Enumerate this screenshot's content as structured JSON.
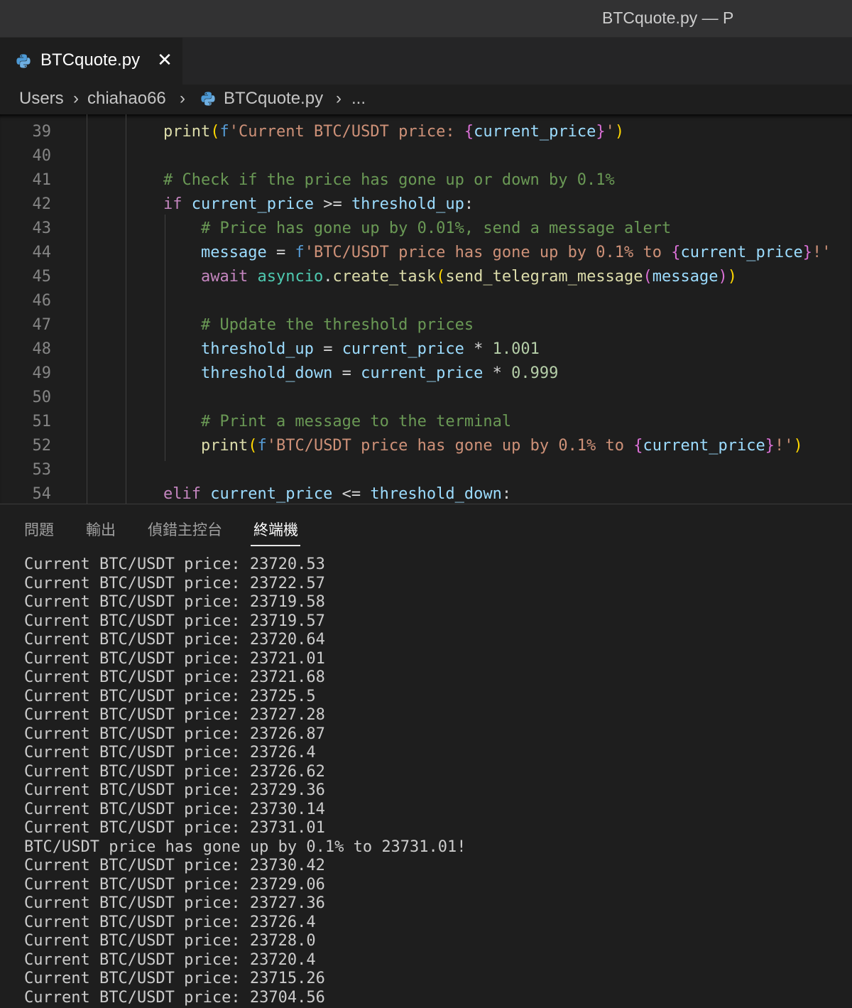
{
  "window": {
    "title": "BTCquote.py — P"
  },
  "tabs": [
    {
      "label": "BTCquote.py",
      "close": "✕"
    }
  ],
  "breadcrumb": {
    "items": [
      "Users",
      "chiahao66",
      "BTCquote.py",
      "..."
    ],
    "separator": "›"
  },
  "editor": {
    "lines": [
      {
        "num": "39",
        "text": "print(f'Current BTC/USDT price: {current_price}')"
      },
      {
        "num": "40",
        "text": ""
      },
      {
        "num": "41",
        "text": "# Check if the price has gone up or down by 0.1%"
      },
      {
        "num": "42",
        "text": "if current_price >= threshold_up:"
      },
      {
        "num": "43",
        "text": "    # Price has gone up by 0.01%, send a message alert"
      },
      {
        "num": "44",
        "text": "    message = f'BTC/USDT price has gone up by 0.1% to {current_price}!'"
      },
      {
        "num": "45",
        "text": "    await asyncio.create_task(send_telegram_message(message))"
      },
      {
        "num": "46",
        "text": ""
      },
      {
        "num": "47",
        "text": "    # Update the threshold prices"
      },
      {
        "num": "48",
        "text": "    threshold_up = current_price * 1.001"
      },
      {
        "num": "49",
        "text": "    threshold_down = current_price * 0.999"
      },
      {
        "num": "50",
        "text": ""
      },
      {
        "num": "51",
        "text": "    # Print a message to the terminal"
      },
      {
        "num": "52",
        "text": "    print(f'BTC/USDT price has gone up by 0.1% to {current_price}!')"
      },
      {
        "num": "53",
        "text": ""
      },
      {
        "num": "54",
        "text": "elif current_price <= threshold_down:"
      }
    ]
  },
  "panel": {
    "tabs": [
      "問題",
      "輸出",
      "偵錯主控台",
      "終端機"
    ],
    "active_tab": "終端機"
  },
  "terminal": {
    "lines": [
      "Current BTC/USDT price: 23720.53",
      "Current BTC/USDT price: 23722.57",
      "Current BTC/USDT price: 23719.58",
      "Current BTC/USDT price: 23719.57",
      "Current BTC/USDT price: 23720.64",
      "Current BTC/USDT price: 23721.01",
      "Current BTC/USDT price: 23721.68",
      "Current BTC/USDT price: 23725.5",
      "Current BTC/USDT price: 23727.28",
      "Current BTC/USDT price: 23726.87",
      "Current BTC/USDT price: 23726.4",
      "Current BTC/USDT price: 23726.62",
      "Current BTC/USDT price: 23729.36",
      "Current BTC/USDT price: 23730.14",
      "Current BTC/USDT price: 23731.01",
      "BTC/USDT price has gone up by 0.1% to 23731.01!",
      "Current BTC/USDT price: 23730.42",
      "Current BTC/USDT price: 23729.06",
      "Current BTC/USDT price: 23727.36",
      "Current BTC/USDT price: 23726.4",
      "Current BTC/USDT price: 23728.0",
      "Current BTC/USDT price: 23720.4",
      "Current BTC/USDT price: 23715.26",
      "Current BTC/USDT price: 23704.56"
    ]
  },
  "icons": {
    "file": "python-icon",
    "close": "close-icon"
  },
  "colors": {
    "keyword": "#c586c0",
    "function": "#dcdcaa",
    "string": "#ce9178",
    "variable": "#9cdcfe",
    "comment": "#6a9955",
    "number": "#b5cea8"
  }
}
